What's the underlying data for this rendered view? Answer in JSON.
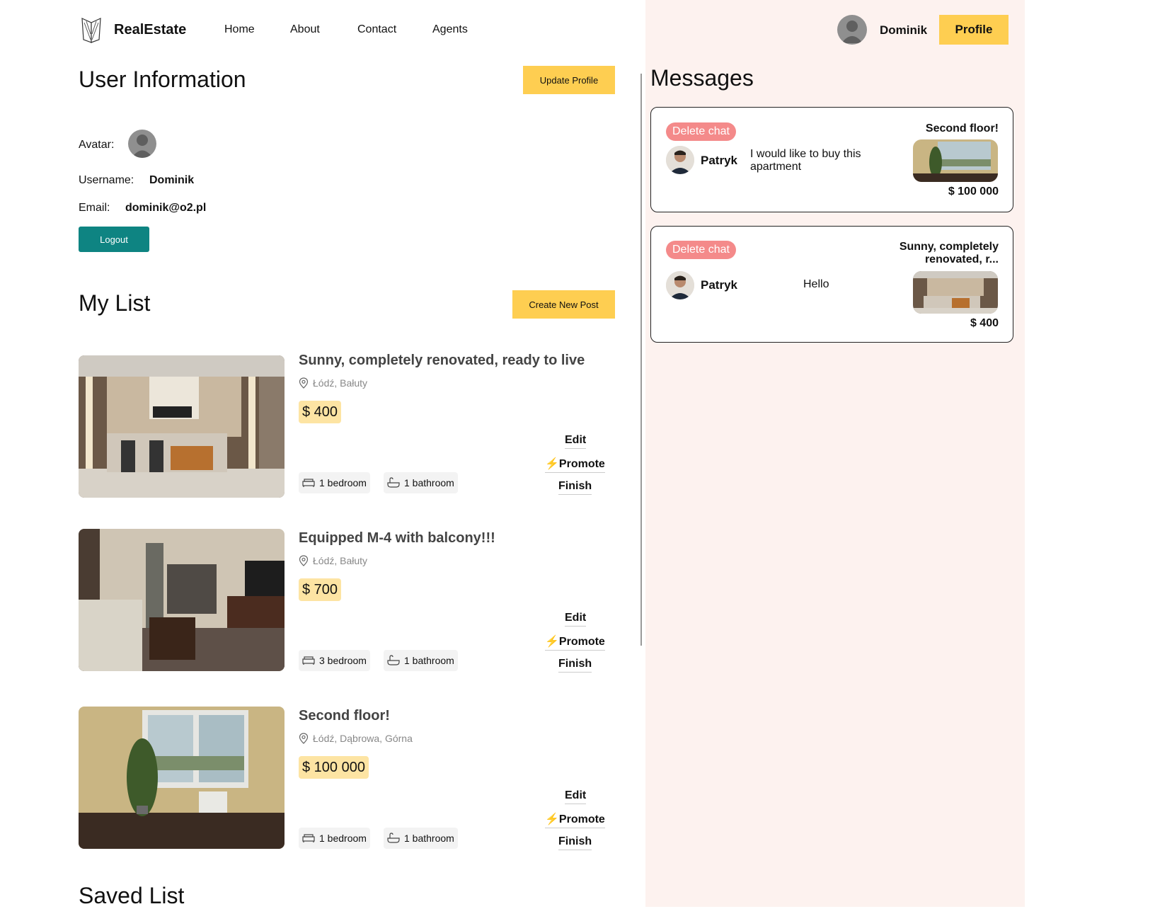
{
  "nav": {
    "brand": "RealEstate",
    "links": [
      "Home",
      "About",
      "Contact",
      "Agents"
    ],
    "username": "Dominik",
    "profile_label": "Profile"
  },
  "user_info": {
    "title": "User Information",
    "update_label": "Update Profile",
    "avatar_label": "Avatar:",
    "username_label": "Username:",
    "username": "Dominik",
    "email_label": "Email:",
    "email": "dominik@o2.pl",
    "logout_label": "Logout"
  },
  "my_list": {
    "title": "My List",
    "create_label": "Create New Post",
    "posts": [
      {
        "title": "Sunny, completely renovated, ready to live",
        "address": "Łódź, Bałuty",
        "price": "$ 400",
        "bedroom": "1 bedroom",
        "bathroom": "1 bathroom",
        "edit": "Edit",
        "promote": "Promote",
        "finish": "Finish"
      },
      {
        "title": "Equipped M-4 with balcony!!!",
        "address": "Łódź, Bałuty",
        "price": "$ 700",
        "bedroom": "3 bedroom",
        "bathroom": "1 bathroom",
        "edit": "Edit",
        "promote": "Promote",
        "finish": "Finish"
      },
      {
        "title": "Second floor!",
        "address": "Łódź, Dąbrowa, Górna",
        "price": "$ 100 000",
        "bedroom": "1 bedroom",
        "bathroom": "1 bathroom",
        "edit": "Edit",
        "promote": "Promote",
        "finish": "Finish"
      }
    ]
  },
  "saved_list": {
    "title": "Saved List"
  },
  "messages": {
    "title": "Messages",
    "chats": [
      {
        "delete_label": "Delete chat",
        "sender": "Patryk",
        "message": "I would like to buy this apartment",
        "post_title": "Second floor!",
        "price": "$ 100 000"
      },
      {
        "delete_label": "Delete chat",
        "sender": "Patryk",
        "message": "Hello",
        "post_title": "Sunny, completely renovated, r...",
        "price": "$ 400"
      }
    ]
  },
  "colors": {
    "accent_yellow": "#fece51",
    "logout_teal": "#0e8482",
    "delete_red": "#f48a8a",
    "price_bg": "#fde4a3",
    "messages_bg": "#fdf2ef"
  }
}
